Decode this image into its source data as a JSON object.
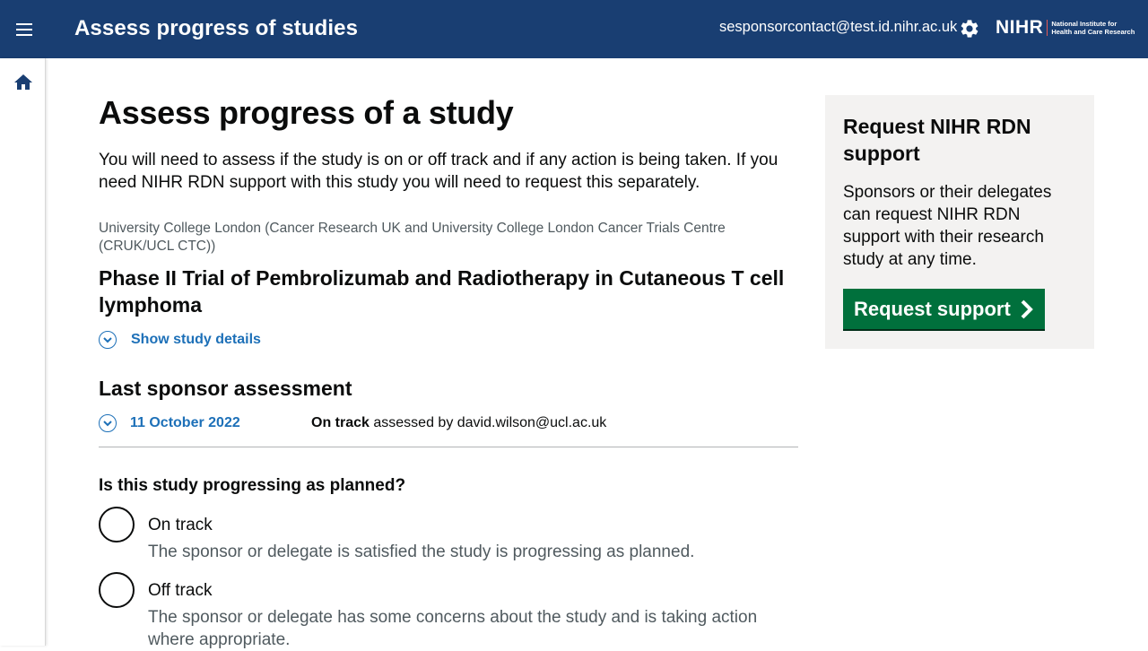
{
  "header": {
    "title": "Assess progress of studies",
    "user_email": "sesponsorcontact@test.id.nihr.ac.uk",
    "logo": {
      "short": "NIHR",
      "line1": "National Institute for",
      "line2": "Health and Care Research"
    },
    "colors": {
      "header_bg": "#193e72",
      "logo_accent": "#e85a53"
    }
  },
  "sidenav": {
    "items": [
      {
        "icon": "home-icon"
      }
    ]
  },
  "main": {
    "page_title": "Assess progress of a study",
    "intro": "You will need to assess if the study is on or off track and if any action is being taken. If you need NIHR RDN support with this study you will need to request this separately.",
    "organisation": "University College London (Cancer Research UK and University College London Cancer Trials Centre (CRUK/UCL CTC))",
    "study_title": "Phase II Trial of Pembrolizumab and Radiotherapy in Cutaneous T cell lymphoma",
    "show_details_label": "Show study details",
    "last_assessment": {
      "heading": "Last sponsor assessment",
      "date": "11 October 2022",
      "status": "On track",
      "assessed_by": "assessed by david.wilson@ucl.ac.uk"
    },
    "question": "Is this study progressing as planned?",
    "options": [
      {
        "label": "On track",
        "hint": "The sponsor or delegate is satisfied the study is progressing as planned."
      },
      {
        "label": "Off track",
        "hint": "The sponsor or delegate has some concerns about the study and is taking action where appropriate."
      }
    ],
    "link_color": "#1d70b8"
  },
  "aside": {
    "heading": "Request NIHR RDN support",
    "body": "Sponsors or their delegates can request NIHR RDN support with their research study at any time.",
    "button_label": "Request support",
    "button_color": "#00703c"
  }
}
